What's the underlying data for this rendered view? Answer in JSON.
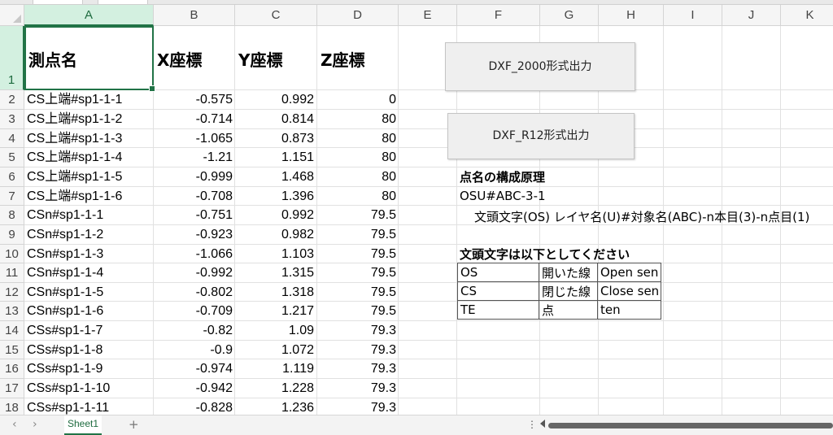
{
  "columns": [
    "A",
    "B",
    "C",
    "D",
    "E",
    "F",
    "G",
    "H",
    "I",
    "J",
    "K"
  ],
  "headers": {
    "A1": "測点名",
    "B1": "X座標",
    "C1": "Y座標",
    "D1": "Z座標",
    "row1": "1"
  },
  "rows": [
    {
      "n": "2",
      "name": "CS上端#sp1-1-1",
      "x": "-0.575",
      "y": "0.992",
      "z": "0"
    },
    {
      "n": "3",
      "name": "CS上端#sp1-1-2",
      "x": "-0.714",
      "y": "0.814",
      "z": "80"
    },
    {
      "n": "4",
      "name": "CS上端#sp1-1-3",
      "x": "-1.065",
      "y": "0.873",
      "z": "80"
    },
    {
      "n": "5",
      "name": "CS上端#sp1-1-4",
      "x": "-1.21",
      "y": "1.151",
      "z": "80"
    },
    {
      "n": "6",
      "name": "CS上端#sp1-1-5",
      "x": "-0.999",
      "y": "1.468",
      "z": "80"
    },
    {
      "n": "7",
      "name": "CS上端#sp1-1-6",
      "x": "-0.708",
      "y": "1.396",
      "z": "80"
    },
    {
      "n": "8",
      "name": "CSn#sp1-1-1",
      "x": "-0.751",
      "y": "0.992",
      "z": "79.5"
    },
    {
      "n": "9",
      "name": "CSn#sp1-1-2",
      "x": "-0.923",
      "y": "0.982",
      "z": "79.5"
    },
    {
      "n": "10",
      "name": "CSn#sp1-1-3",
      "x": "-1.066",
      "y": "1.103",
      "z": "79.5"
    },
    {
      "n": "11",
      "name": "CSn#sp1-1-4",
      "x": "-0.992",
      "y": "1.315",
      "z": "79.5"
    },
    {
      "n": "12",
      "name": "CSn#sp1-1-5",
      "x": "-0.802",
      "y": "1.318",
      "z": "79.5"
    },
    {
      "n": "13",
      "name": "CSn#sp1-1-6",
      "x": "-0.709",
      "y": "1.217",
      "z": "79.5"
    },
    {
      "n": "14",
      "name": "CSs#sp1-1-7",
      "x": "-0.82",
      "y": "1.09",
      "z": "79.3"
    },
    {
      "n": "15",
      "name": "CSs#sp1-1-8",
      "x": "-0.9",
      "y": "1.072",
      "z": "79.3"
    },
    {
      "n": "16",
      "name": "CSs#sp1-1-9",
      "x": "-0.974",
      "y": "1.119",
      "z": "79.3"
    },
    {
      "n": "17",
      "name": "CSs#sp1-1-10",
      "x": "-0.942",
      "y": "1.228",
      "z": "79.3"
    },
    {
      "n": "18",
      "name": "CSs#sp1-1-11",
      "x": "-0.828",
      "y": "1.236",
      "z": "79.3"
    }
  ],
  "buttons": {
    "dxf2000": "DXF_2000形式出力",
    "dxfr12": "DXF_R12形式出力"
  },
  "notes": {
    "heading1": "点名の構成原理",
    "example": "OSU#ABC-3-1",
    "explanation": "文頭文字(OS) レイヤ名(U)#対象名(ABC)-n本目(3)-n点目(1)",
    "heading2": "文頭文字は以下としてください"
  },
  "legend_table": [
    {
      "code": "OS",
      "jp": "開いた線",
      "en": "Open sen"
    },
    {
      "code": "CS",
      "jp": "閉じた線",
      "en": "Close sen"
    },
    {
      "code": "TE",
      "jp": "点",
      "en": "ten"
    }
  ],
  "sheet": {
    "tab": "Sheet1",
    "add": "+",
    "prev": "‹",
    "next": "›",
    "more": "⋮"
  },
  "colors": {
    "accent": "#217346",
    "header_bg": "#f5f5f5",
    "grid": "#e1e1e1"
  }
}
